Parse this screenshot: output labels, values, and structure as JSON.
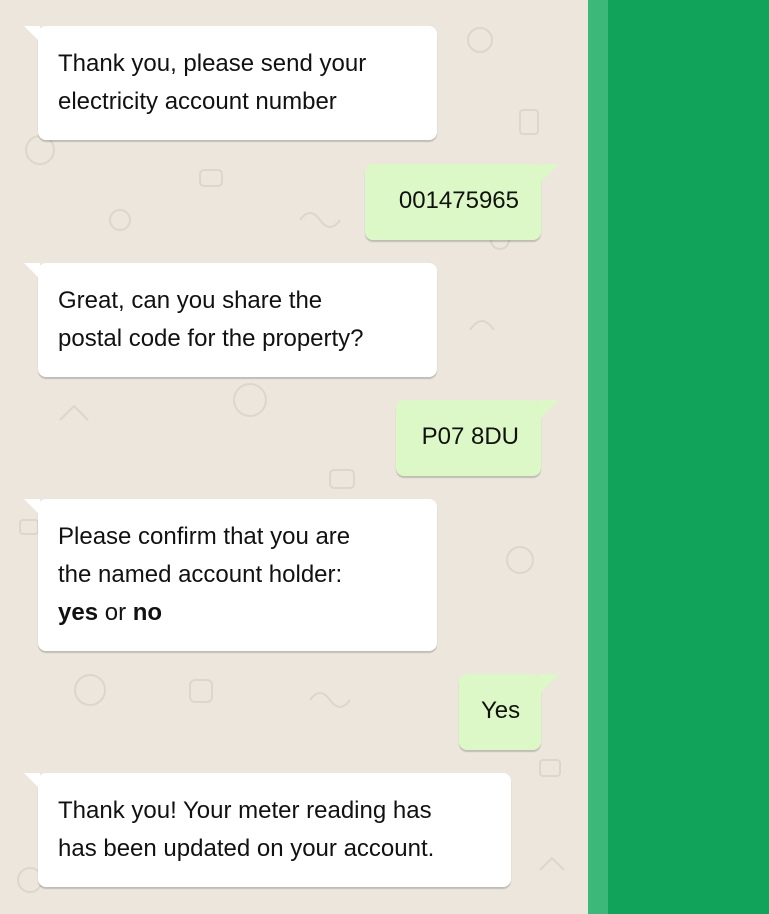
{
  "messages": [
    {
      "direction": "incoming",
      "lines": [
        "Thank you, please send your",
        "electricity account number"
      ]
    },
    {
      "direction": "outgoing",
      "lines": [
        "001475965"
      ]
    },
    {
      "direction": "incoming",
      "lines": [
        "Great, can you share the",
        "postal code for the property?"
      ]
    },
    {
      "direction": "outgoing",
      "lines": [
        "P07 8DU"
      ]
    },
    {
      "direction": "incoming",
      "lines": [
        "Please confirm that you are",
        "the named account holder:"
      ],
      "options": {
        "first": "yes",
        "separator": "or",
        "second": "no"
      }
    },
    {
      "direction": "outgoing",
      "lines": [
        "Yes"
      ]
    },
    {
      "direction": "incoming",
      "lines": [
        "Thank you! Your meter reading has",
        "has been updated on your account."
      ]
    }
  ],
  "colors": {
    "chat_background": "#ece6dd",
    "incoming_bubble": "#ffffff",
    "outgoing_bubble": "#dcf8c6",
    "side_panel": "#12a35a",
    "edge_stripe": "#3cb878",
    "text": "#111111"
  }
}
